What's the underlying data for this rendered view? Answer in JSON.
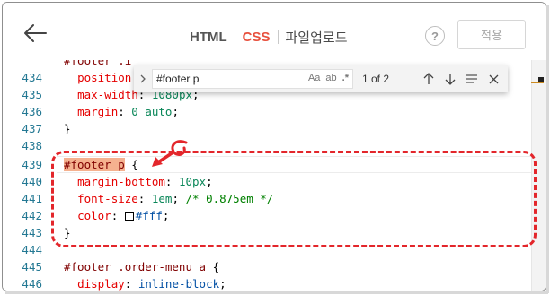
{
  "header": {
    "tabs": [
      {
        "label": "HTML",
        "active": false
      },
      {
        "label": "CSS",
        "active": true
      },
      {
        "label": "파일업로드",
        "active": false
      }
    ],
    "help_label": "?",
    "apply_label": "적용",
    "accent_color": "#e8513e"
  },
  "find_widget": {
    "query": "#footer p",
    "option_case": "Aa",
    "option_word": "ab",
    "option_regex": ".*",
    "match_count": "1 of 2",
    "prev_icon": "arrow-up-icon",
    "next_icon": "arrow-down-icon",
    "selection_icon": "find-in-selection-icon",
    "close_icon": "close-icon"
  },
  "editor": {
    "lines": [
      {
        "num": "434",
        "text": "  position: "
      },
      {
        "num": "435",
        "text": "  max-width: 1080px;"
      },
      {
        "num": "436",
        "text": "  margin: 0 auto;"
      },
      {
        "num": "437",
        "text": "}"
      },
      {
        "num": "438",
        "text": ""
      },
      {
        "num": "439",
        "text": "#footer p {"
      },
      {
        "num": "440",
        "text": "  margin-bottom: 10px;"
      },
      {
        "num": "441",
        "text": "  font-size: 1em; /* 0.875em */"
      },
      {
        "num": "442",
        "text": "  color: #fff;"
      },
      {
        "num": "443",
        "text": "}"
      },
      {
        "num": "444",
        "text": ""
      },
      {
        "num": "445",
        "text": "#footer .order-menu a {"
      },
      {
        "num": "446",
        "text": "  display: inline-block;"
      }
    ],
    "partial_top_line": "#footer .i",
    "tokens": {
      "l434_prop": "position",
      "l435_prop": "max-width",
      "l435_val": "1080px",
      "l436_prop": "margin",
      "l436_val": "0 auto",
      "l439_sel": "#footer p",
      "l440_prop": "margin-bottom",
      "l440_val": "10px",
      "l441_prop": "font-size",
      "l441_val": "1em",
      "l441_cmt": "/* 0.875em */",
      "l442_prop": "color",
      "l442_val": "#fff",
      "l445_sel": "#footer .order-menu a",
      "l446_prop": "display",
      "l446_val": "inline-block"
    }
  }
}
